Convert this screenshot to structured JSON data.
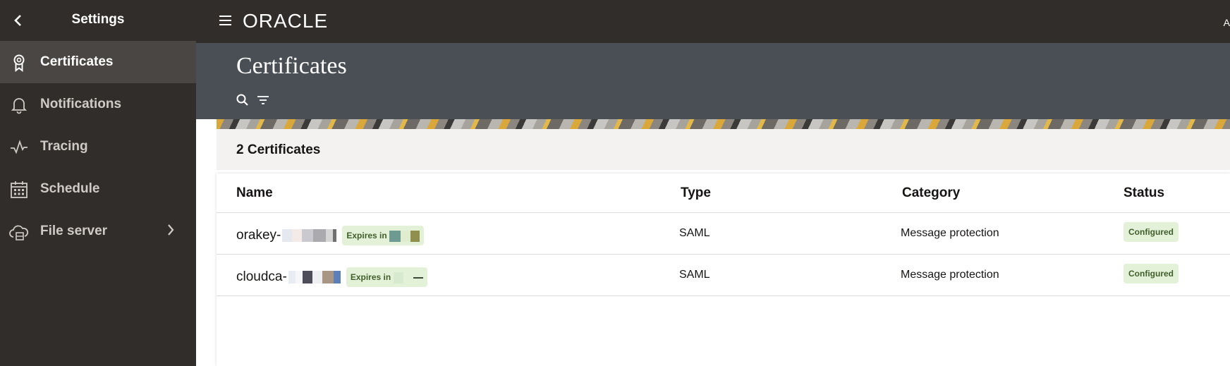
{
  "sidebar": {
    "title": "Settings",
    "items": [
      {
        "label": "Certificates",
        "icon": "certificate-icon",
        "active": true
      },
      {
        "label": "Notifications",
        "icon": "bell-icon",
        "active": false
      },
      {
        "label": "Tracing",
        "icon": "pulse-icon",
        "active": false
      },
      {
        "label": "Schedule",
        "icon": "calendar-icon",
        "active": false
      },
      {
        "label": "File server",
        "icon": "cloud-server-icon",
        "active": false
      }
    ]
  },
  "topbar": {
    "logo": "ORACLE",
    "corner_char": "A"
  },
  "page": {
    "title": "Certificates"
  },
  "list": {
    "count_label": "2 Certificates",
    "columns": [
      "Name",
      "Type",
      "Category",
      "Status"
    ],
    "rows": [
      {
        "name_prefix": "orakey-",
        "expires_label": "Expires in",
        "type": "SAML",
        "category": "Message protection",
        "status": "Configured"
      },
      {
        "name_prefix": "cloudca-",
        "expires_label": "Expires in",
        "type": "SAML",
        "category": "Message protection",
        "status": "Configured"
      }
    ]
  },
  "colors": {
    "sidebar_bg": "#312d2a",
    "active_item_bg": "#4a4643",
    "header_bg": "#4a4f56",
    "badge_bg": "#e4f1d9",
    "badge_text": "#3f5e2a"
  }
}
